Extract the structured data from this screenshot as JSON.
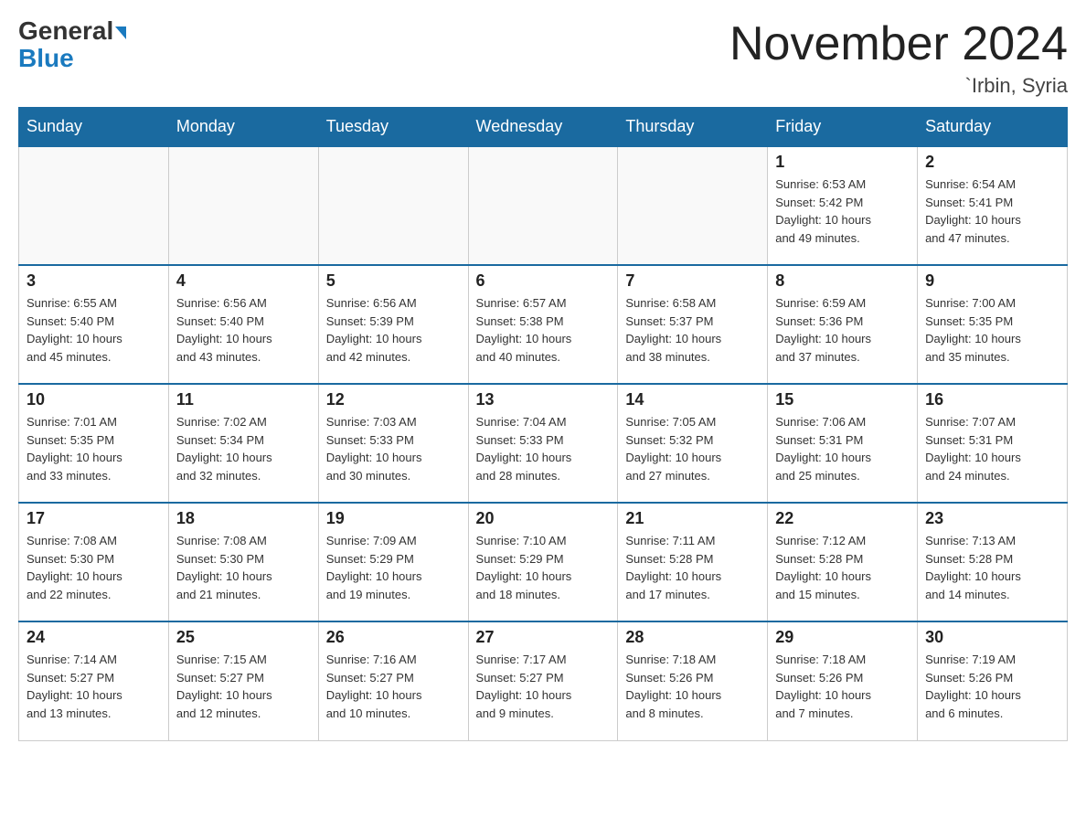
{
  "logo": {
    "top": "General",
    "bottom": "Blue"
  },
  "title": "November 2024",
  "location": "`Irbin, Syria",
  "days_of_week": [
    "Sunday",
    "Monday",
    "Tuesday",
    "Wednesday",
    "Thursday",
    "Friday",
    "Saturday"
  ],
  "weeks": [
    [
      {
        "day": "",
        "info": ""
      },
      {
        "day": "",
        "info": ""
      },
      {
        "day": "",
        "info": ""
      },
      {
        "day": "",
        "info": ""
      },
      {
        "day": "",
        "info": ""
      },
      {
        "day": "1",
        "info": "Sunrise: 6:53 AM\nSunset: 5:42 PM\nDaylight: 10 hours\nand 49 minutes."
      },
      {
        "day": "2",
        "info": "Sunrise: 6:54 AM\nSunset: 5:41 PM\nDaylight: 10 hours\nand 47 minutes."
      }
    ],
    [
      {
        "day": "3",
        "info": "Sunrise: 6:55 AM\nSunset: 5:40 PM\nDaylight: 10 hours\nand 45 minutes."
      },
      {
        "day": "4",
        "info": "Sunrise: 6:56 AM\nSunset: 5:40 PM\nDaylight: 10 hours\nand 43 minutes."
      },
      {
        "day": "5",
        "info": "Sunrise: 6:56 AM\nSunset: 5:39 PM\nDaylight: 10 hours\nand 42 minutes."
      },
      {
        "day": "6",
        "info": "Sunrise: 6:57 AM\nSunset: 5:38 PM\nDaylight: 10 hours\nand 40 minutes."
      },
      {
        "day": "7",
        "info": "Sunrise: 6:58 AM\nSunset: 5:37 PM\nDaylight: 10 hours\nand 38 minutes."
      },
      {
        "day": "8",
        "info": "Sunrise: 6:59 AM\nSunset: 5:36 PM\nDaylight: 10 hours\nand 37 minutes."
      },
      {
        "day": "9",
        "info": "Sunrise: 7:00 AM\nSunset: 5:35 PM\nDaylight: 10 hours\nand 35 minutes."
      }
    ],
    [
      {
        "day": "10",
        "info": "Sunrise: 7:01 AM\nSunset: 5:35 PM\nDaylight: 10 hours\nand 33 minutes."
      },
      {
        "day": "11",
        "info": "Sunrise: 7:02 AM\nSunset: 5:34 PM\nDaylight: 10 hours\nand 32 minutes."
      },
      {
        "day": "12",
        "info": "Sunrise: 7:03 AM\nSunset: 5:33 PM\nDaylight: 10 hours\nand 30 minutes."
      },
      {
        "day": "13",
        "info": "Sunrise: 7:04 AM\nSunset: 5:33 PM\nDaylight: 10 hours\nand 28 minutes."
      },
      {
        "day": "14",
        "info": "Sunrise: 7:05 AM\nSunset: 5:32 PM\nDaylight: 10 hours\nand 27 minutes."
      },
      {
        "day": "15",
        "info": "Sunrise: 7:06 AM\nSunset: 5:31 PM\nDaylight: 10 hours\nand 25 minutes."
      },
      {
        "day": "16",
        "info": "Sunrise: 7:07 AM\nSunset: 5:31 PM\nDaylight: 10 hours\nand 24 minutes."
      }
    ],
    [
      {
        "day": "17",
        "info": "Sunrise: 7:08 AM\nSunset: 5:30 PM\nDaylight: 10 hours\nand 22 minutes."
      },
      {
        "day": "18",
        "info": "Sunrise: 7:08 AM\nSunset: 5:30 PM\nDaylight: 10 hours\nand 21 minutes."
      },
      {
        "day": "19",
        "info": "Sunrise: 7:09 AM\nSunset: 5:29 PM\nDaylight: 10 hours\nand 19 minutes."
      },
      {
        "day": "20",
        "info": "Sunrise: 7:10 AM\nSunset: 5:29 PM\nDaylight: 10 hours\nand 18 minutes."
      },
      {
        "day": "21",
        "info": "Sunrise: 7:11 AM\nSunset: 5:28 PM\nDaylight: 10 hours\nand 17 minutes."
      },
      {
        "day": "22",
        "info": "Sunrise: 7:12 AM\nSunset: 5:28 PM\nDaylight: 10 hours\nand 15 minutes."
      },
      {
        "day": "23",
        "info": "Sunrise: 7:13 AM\nSunset: 5:28 PM\nDaylight: 10 hours\nand 14 minutes."
      }
    ],
    [
      {
        "day": "24",
        "info": "Sunrise: 7:14 AM\nSunset: 5:27 PM\nDaylight: 10 hours\nand 13 minutes."
      },
      {
        "day": "25",
        "info": "Sunrise: 7:15 AM\nSunset: 5:27 PM\nDaylight: 10 hours\nand 12 minutes."
      },
      {
        "day": "26",
        "info": "Sunrise: 7:16 AM\nSunset: 5:27 PM\nDaylight: 10 hours\nand 10 minutes."
      },
      {
        "day": "27",
        "info": "Sunrise: 7:17 AM\nSunset: 5:27 PM\nDaylight: 10 hours\nand 9 minutes."
      },
      {
        "day": "28",
        "info": "Sunrise: 7:18 AM\nSunset: 5:26 PM\nDaylight: 10 hours\nand 8 minutes."
      },
      {
        "day": "29",
        "info": "Sunrise: 7:18 AM\nSunset: 5:26 PM\nDaylight: 10 hours\nand 7 minutes."
      },
      {
        "day": "30",
        "info": "Sunrise: 7:19 AM\nSunset: 5:26 PM\nDaylight: 10 hours\nand 6 minutes."
      }
    ]
  ]
}
